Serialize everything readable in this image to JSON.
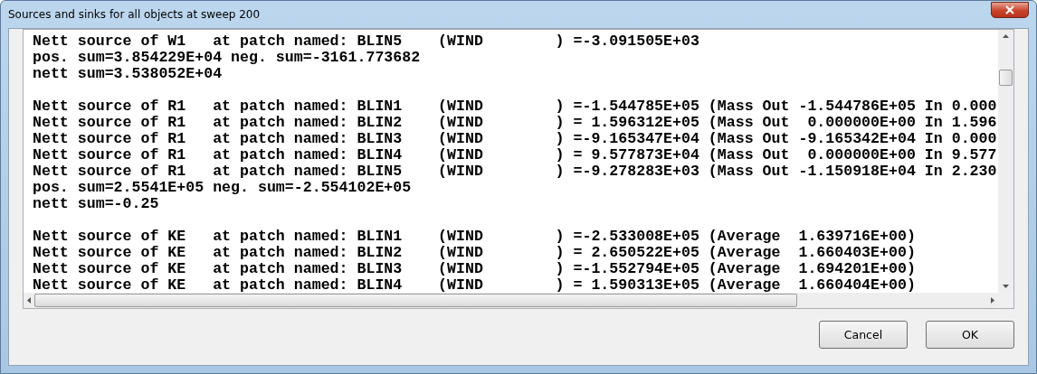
{
  "window": {
    "title": "Sources and sinks for all objects at sweep 200"
  },
  "blocks": [
    {
      "lines": [
        "Nett source of W1   at patch named: BLIN5    (WIND        ) =-3.091505E+03",
        "pos. sum=3.854229E+04 neg. sum=-3161.773682",
        "nett sum=3.538052E+04"
      ]
    },
    {
      "lines": [
        "Nett source of R1   at patch named: BLIN1    (WIND        ) =-1.544785E+05 (Mass Out -1.544786E+05 In 0.000",
        "Nett source of R1   at patch named: BLIN2    (WIND        ) = 1.596312E+05 (Mass Out  0.000000E+00 In 1.596",
        "Nett source of R1   at patch named: BLIN3    (WIND        ) =-9.165347E+04 (Mass Out -9.165342E+04 In 0.000",
        "Nett source of R1   at patch named: BLIN4    (WIND        ) = 9.577873E+04 (Mass Out  0.000000E+00 In 9.577",
        "Nett source of R1   at patch named: BLIN5    (WIND        ) =-9.278283E+03 (Mass Out -1.150918E+04 In 2.230",
        "pos. sum=2.5541E+05 neg. sum=-2.554102E+05",
        "nett sum=-0.25"
      ]
    },
    {
      "lines": [
        "Nett source of KE   at patch named: BLIN1    (WIND        ) =-2.533008E+05 (Average  1.639716E+00)",
        "Nett source of KE   at patch named: BLIN2    (WIND        ) = 2.650522E+05 (Average  1.660403E+00)",
        "Nett source of KE   at patch named: BLIN3    (WIND        ) =-1.552794E+05 (Average  1.694201E+00)",
        "Nett source of KE   at patch named: BLIN4    (WIND        ) = 1.590313E+05 (Average  1.660404E+00)"
      ]
    }
  ],
  "buttons": [
    {
      "label": "Cancel"
    },
    {
      "label": "OK"
    }
  ]
}
